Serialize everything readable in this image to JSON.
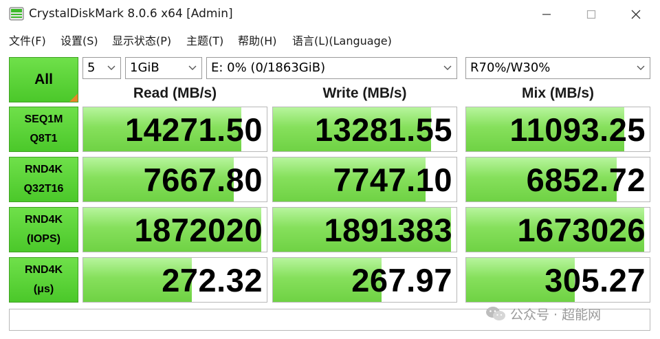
{
  "window": {
    "title": "CrystalDiskMark 8.0.6 x64 [Admin]",
    "icon": "crystaldiskmark-app-icon",
    "controls": [
      "minimize-icon",
      "maximize-icon",
      "close-icon"
    ]
  },
  "menu": {
    "items": [
      {
        "label": "文件(F)"
      },
      {
        "label": "设置(S)"
      },
      {
        "label": "显示状态(P)"
      },
      {
        "label": "主题(T)"
      },
      {
        "label": "帮助(H)"
      },
      {
        "label": "语言(L)(Language)"
      }
    ]
  },
  "toolbar": {
    "all_label": "All",
    "count": "5",
    "size": "1GiB",
    "drive": "E: 0% (0/1863GiB)",
    "mix_ratio": "R70%/W30%"
  },
  "columns": {
    "read": "Read (MB/s)",
    "write": "Write (MB/s)",
    "mix": "Mix (MB/s)"
  },
  "rows": [
    {
      "label_line1": "SEQ1M",
      "label_line2": "Q8T1",
      "read": "14271.50",
      "write": "13281.55",
      "mix": "11093.25",
      "read_fill": 0.86,
      "write_fill": 0.86,
      "mix_fill": 0.86
    },
    {
      "label_line1": "RND4K",
      "label_line2": "Q32T16",
      "read": "7667.80",
      "write": "7747.10",
      "mix": "6852.72",
      "read_fill": 0.82,
      "write_fill": 0.83,
      "mix_fill": 0.82
    },
    {
      "label_line1": "RND4K",
      "label_line2": "(IOPS)",
      "read": "1872020",
      "write": "1891383",
      "mix": "1673026",
      "read_fill": 0.97,
      "write_fill": 0.97,
      "mix_fill": 0.97
    },
    {
      "label_line1": "RND4K",
      "label_line2": "(μs)",
      "read": "272.32",
      "write": "267.97",
      "mix": "305.27",
      "read_fill": 0.59,
      "write_fill": 0.59,
      "mix_fill": 0.59
    }
  ],
  "status": "",
  "watermark": {
    "text": "公众号 · 超能网",
    "icon": "wechat-icon"
  },
  "colors": {
    "accent_green": "#4bc82a",
    "bar_green": "#86e05c",
    "corner_orange": "#e8842a"
  }
}
